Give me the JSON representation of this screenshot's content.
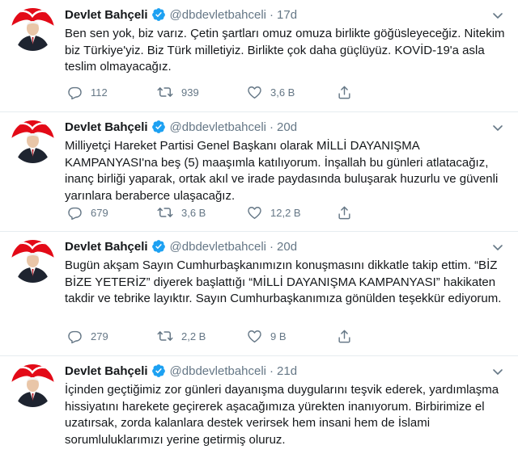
{
  "author": {
    "name": "Devlet Bahçeli",
    "handle": "@dbdevletbahceli",
    "separator": "·"
  },
  "colors": {
    "verified_badge": "#1da1f2",
    "muted_text": "#657786",
    "divider": "#e6ecf0",
    "avatar_red": "#e30a17"
  },
  "icons": {
    "verified": "verified-badge-icon",
    "more": "chevron-down-icon",
    "reply": "reply-icon",
    "retweet": "retweet-icon",
    "like": "heart-icon",
    "share": "share-icon"
  },
  "tweets": [
    {
      "time": "17d",
      "text": "Ben sen yok, biz varız. Çetin şartları omuz omuza birlikte göğüsleyeceğiz. Nitekim biz Türkiye'yiz. Biz Türk milletiyiz. Birlikte çok daha güçlüyüz. KOVİD-19'a asla teslim olmayacağız.",
      "replies": "112",
      "retweets": "939",
      "likes": "3,6 B"
    },
    {
      "time": "20d",
      "text": "Milliyetçi Hareket Partisi Genel Başkanı olarak MİLLİ DAYANIŞMA KAMPANYASI'na beş (5) maaşımla katılıyorum. İnşallah bu günleri atlatacağız, inanç birliği yaparak, ortak akıl ve irade paydasında buluşarak huzurlu ve güvenli yarınlara beraberce ulaşacağız.",
      "replies": "679",
      "retweets": "3,6 B",
      "likes": "12,2 B"
    },
    {
      "time": "20d",
      "text": "Bugün akşam Sayın Cumhurbaşkanımızın konuşmasını dikkatle takip ettim. “BİZ BİZE YETERİZ” diyerek başlattığı “MİLLİ DAYANIŞMA KAMPANYASI” hakikaten takdir ve tebrike layıktır. Sayın Cumhurbaşkanımıza gönülden teşekkür ediyorum.",
      "replies": "279",
      "retweets": "2,2 B",
      "likes": "9 B"
    },
    {
      "time": "21d",
      "text": "İçinden geçtiğimiz zor günleri dayanışma duygularını teşvik ederek, yardımlaşma hissiyatını harekete geçirerek aşacağımıza yürekten inanıyorum. Birbirimize el uzatırsak, zorda kalanlara destek verirsek hem insani hem de İslami sorumluluklarımızı yerine getirmiş oluruz."
    }
  ]
}
